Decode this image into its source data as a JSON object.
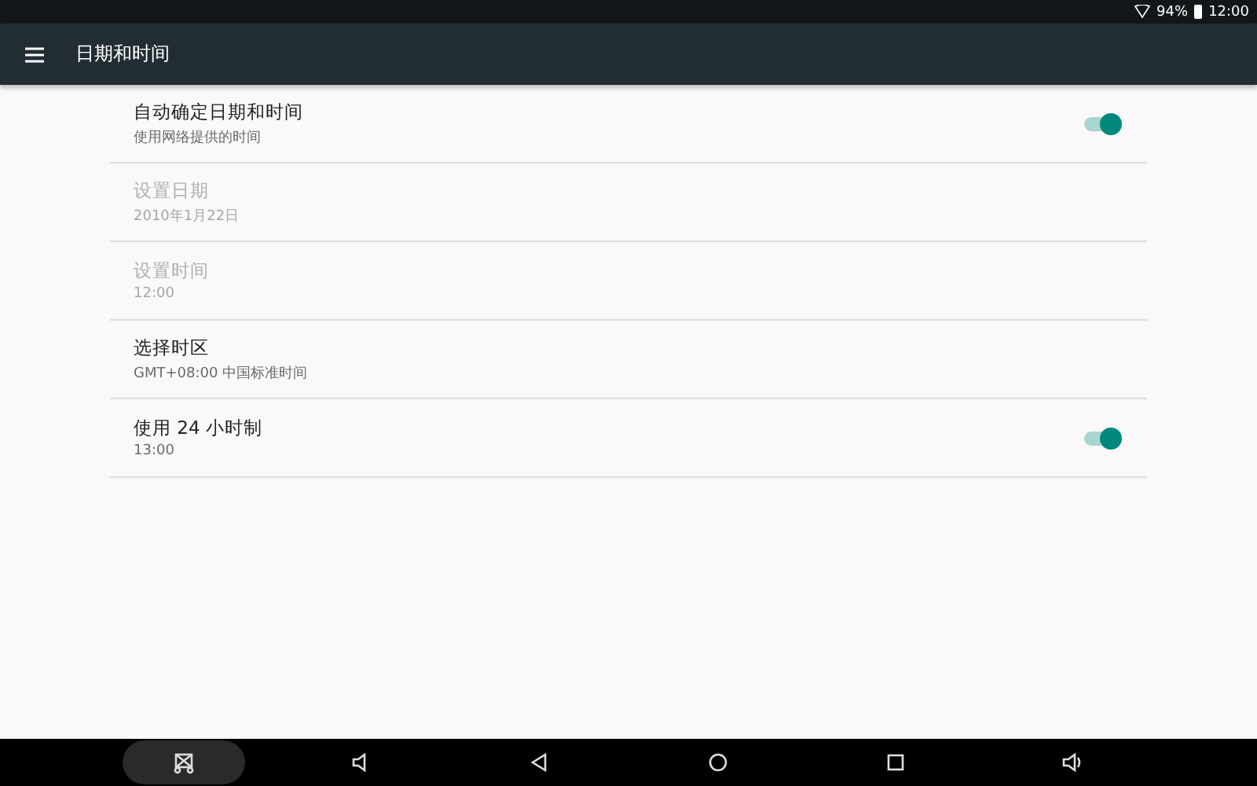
{
  "status_bar": {
    "battery": "94%",
    "time": "12:00"
  },
  "toolbar": {
    "title": "日期和时间"
  },
  "settings": [
    {
      "kind": "switch",
      "title": "自动确定日期和时间",
      "summary": "使用网络提供的时间",
      "disabled": false,
      "on": true
    },
    {
      "kind": "plain",
      "title": "设置日期",
      "summary": "2010年1月22日",
      "disabled": true
    },
    {
      "kind": "plain",
      "title": "设置时间",
      "summary": "12:00",
      "disabled": true
    },
    {
      "kind": "plain",
      "title": "选择时区",
      "summary": "GMT+08:00 中国标准时间",
      "disabled": false
    },
    {
      "kind": "switch",
      "title": "使用 24 小时制",
      "summary": "13:00",
      "disabled": false,
      "on": true
    }
  ]
}
